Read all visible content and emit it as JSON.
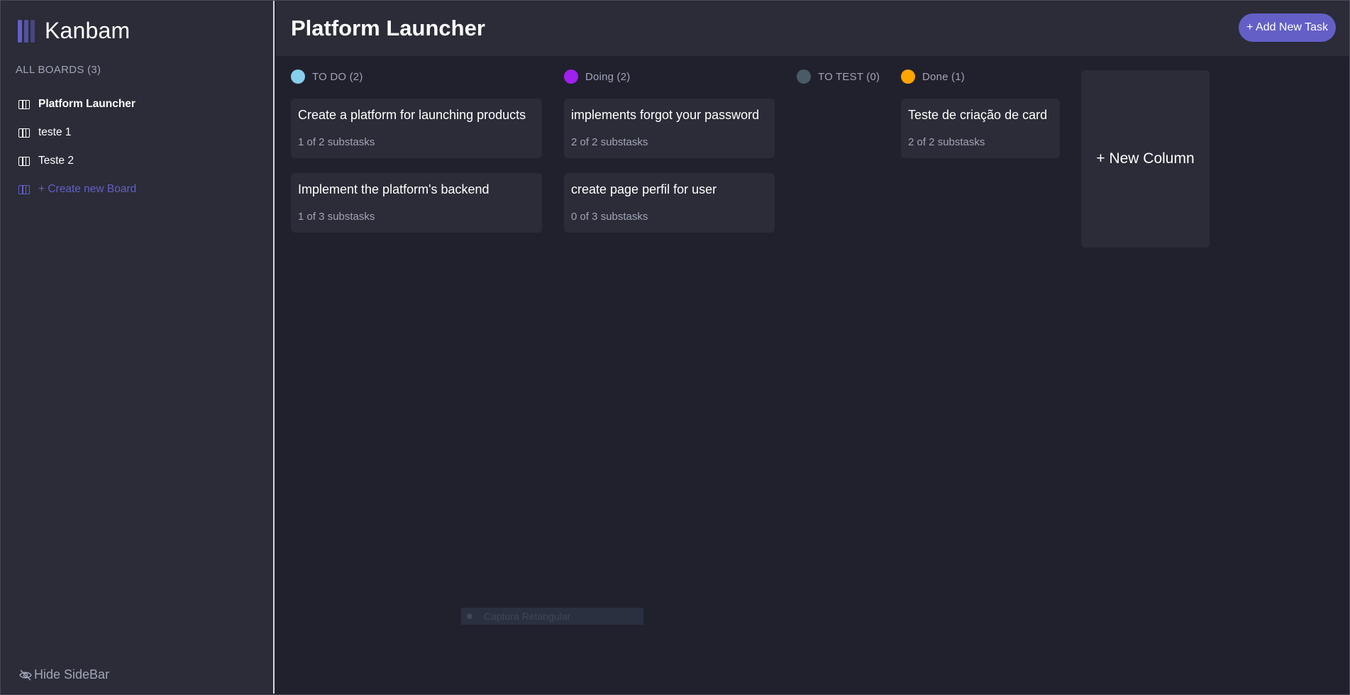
{
  "app": {
    "name": "Kanbam",
    "accent": "#635fc7"
  },
  "sidebar": {
    "boards_heading": "ALL BOARDS (3)",
    "boards": [
      {
        "label": "Platform Launcher",
        "active": true
      },
      {
        "label": "teste 1",
        "active": false
      },
      {
        "label": "Teste 2",
        "active": false
      }
    ],
    "create_label": "+ Create new Board",
    "hide_label": "Hide SideBar"
  },
  "header": {
    "title": "Platform Launcher",
    "add_task_label": "+ Add New Task"
  },
  "columns": [
    {
      "title": "TO DO (2)",
      "color": "#87ceeb",
      "cards": [
        {
          "title": "Create a platform for launching products",
          "subtasks": "1 of 2 substasks"
        },
        {
          "title": "Implement the platform's backend",
          "subtasks": "1 of 3 substasks"
        }
      ]
    },
    {
      "title": "Doing (2)",
      "color": "#a020f0",
      "cards": [
        {
          "title": "implements forgot your password",
          "subtasks": "2 of 2 substasks"
        },
        {
          "title": "create page perfil for user",
          "subtasks": "0 of 3 substasks"
        }
      ]
    },
    {
      "title": "TO TEST (0)",
      "color": "#4a5a66",
      "cards": []
    },
    {
      "title": "Done (1)",
      "color": "#ffa500",
      "cards": [
        {
          "title": "Teste de criação de card",
          "subtasks": "2 of 2 substasks"
        }
      ]
    }
  ],
  "new_column_label": "+ New Column",
  "overlay": {
    "label": "Captura Retangular"
  }
}
